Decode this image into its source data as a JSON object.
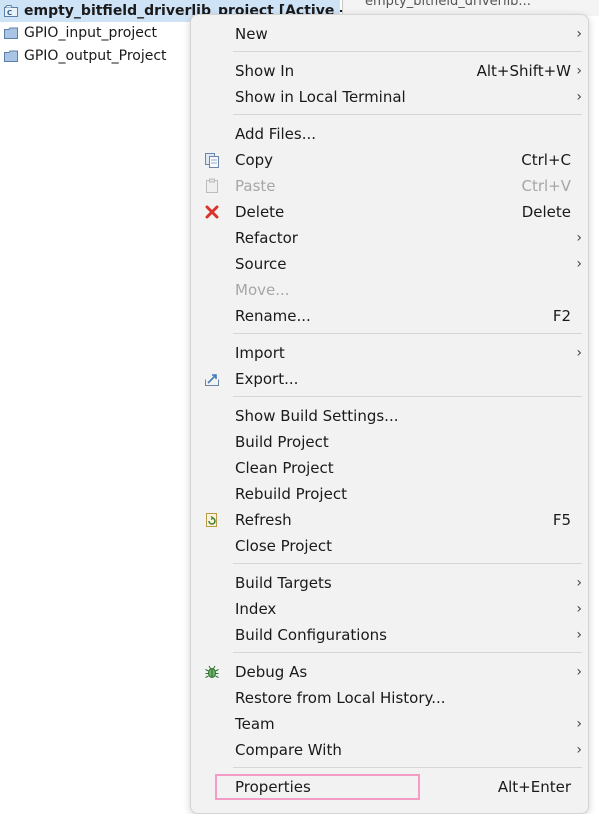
{
  "tree": {
    "active_project": "empty_bitfield_driverlib_project  [Active -",
    "items": [
      "GPIO_input_project",
      "GPIO_output_Project"
    ]
  },
  "right_pane": {
    "tab_text": "empty_bitfield_driverlib..."
  },
  "menu": {
    "new": "New",
    "show_in": "Show In",
    "show_in_shortcut": "Alt+Shift+W",
    "show_local_terminal": "Show in Local Terminal",
    "add_files": "Add Files...",
    "copy": "Copy",
    "copy_shortcut": "Ctrl+C",
    "paste": "Paste",
    "paste_shortcut": "Ctrl+V",
    "delete": "Delete",
    "delete_shortcut": "Delete",
    "refactor": "Refactor",
    "source": "Source",
    "move": "Move...",
    "rename": "Rename...",
    "rename_shortcut": "F2",
    "import": "Import",
    "export": "Export...",
    "show_build_settings": "Show Build Settings...",
    "build_project": "Build Project",
    "clean_project": "Clean Project",
    "rebuild_project": "Rebuild Project",
    "refresh": "Refresh",
    "refresh_shortcut": "F5",
    "close_project": "Close Project",
    "build_targets": "Build Targets",
    "index": "Index",
    "build_configurations": "Build Configurations",
    "debug_as": "Debug As",
    "restore_history": "Restore from Local History...",
    "team": "Team",
    "compare_with": "Compare With",
    "properties": "Properties",
    "properties_shortcut": "Alt+Enter"
  },
  "colors": {
    "menu_bg": "#f2f2f2",
    "selection_bg": "#cfe3f7",
    "highlight_box": "#f59cc4",
    "delete_icon": "#d9342b",
    "debug_icon": "#3a8f3a"
  }
}
